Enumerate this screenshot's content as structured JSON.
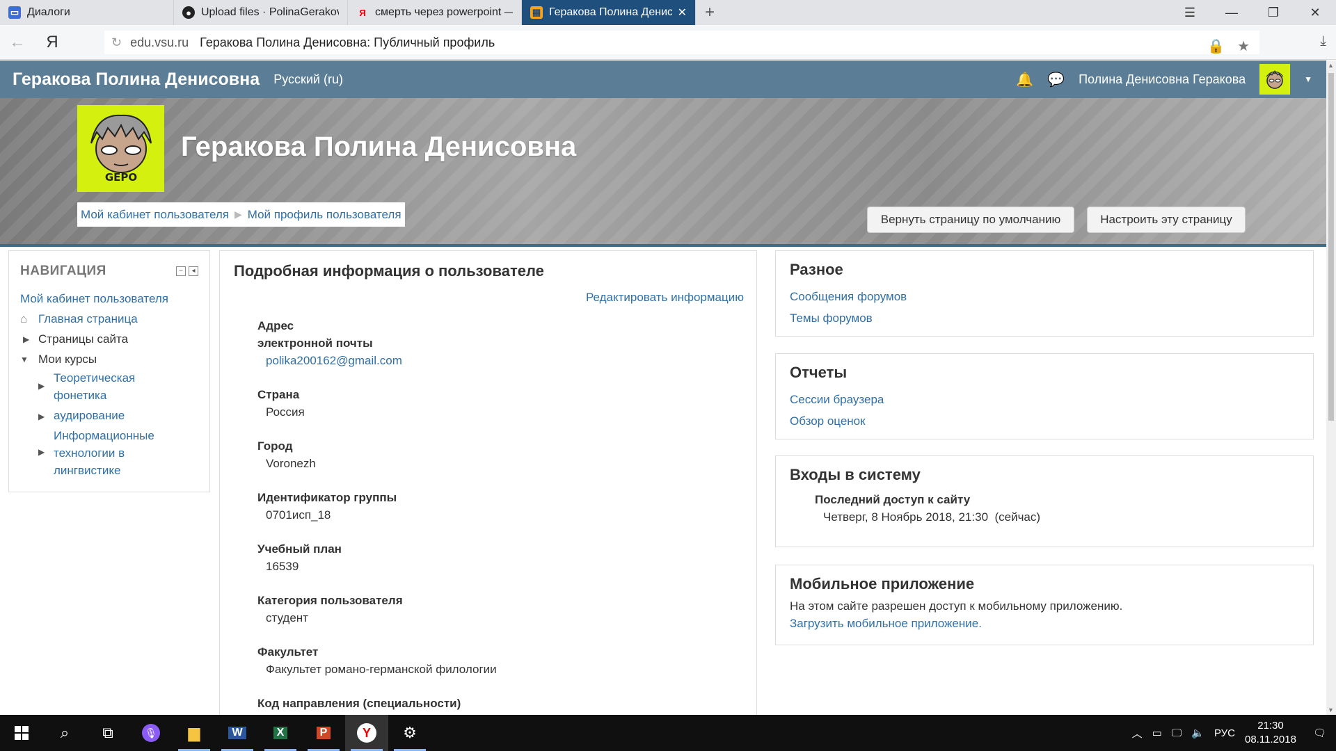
{
  "browser": {
    "tabs": [
      {
        "title": "Диалоги",
        "icon": "chat-icon",
        "active": false
      },
      {
        "title": "Upload files · PolinaGerakova",
        "icon": "github-icon",
        "active": false
      },
      {
        "title": "смерть через powerpoint —",
        "icon": "yandex-icon",
        "active": false
      },
      {
        "title": "Геракова Полина Денисовна",
        "icon": "moodle-icon",
        "active": true
      }
    ],
    "url_domain": "edu.vsu.ru",
    "url_title": "Геракова Полина Денисовна: Публичный профиль"
  },
  "navbar": {
    "brand": "Геракова Полина Денисовна",
    "lang": "Русский (ru)",
    "username": "Полина Денисовна Геракова"
  },
  "header": {
    "title": "Геракова Полина Денисовна",
    "avatar_text": "GEPO",
    "breadcrumb": [
      "Мой кабинет пользователя",
      "Мой профиль пользователя"
    ],
    "reset_button": "Вернуть страницу по умолчанию",
    "customize_button": "Настроить эту страницу"
  },
  "navigation": {
    "title": "НАВИГАЦИЯ",
    "dashboard": "Мой кабинет пользователя",
    "home": "Главная страница",
    "site_pages": "Страницы сайта",
    "my_courses": "Мои курсы",
    "courses": [
      {
        "line1": "Теоретическая",
        "line2": "фонетика",
        "line3": ""
      },
      {
        "line1": "аудирование",
        "line2": "",
        "line3": ""
      },
      {
        "line1": "Информационные",
        "line2": "технологии в",
        "line3": "лингвистике"
      }
    ]
  },
  "details": {
    "title": "Подробная информация о пользователе",
    "edit_link": "Редактировать информацию",
    "fields": [
      {
        "label1": "Адрес",
        "label2": "электронной почты",
        "value": "polika200162@gmail.com",
        "is_link": true
      },
      {
        "label1": "Страна",
        "label2": "",
        "value": "Россия",
        "is_link": false
      },
      {
        "label1": "Город",
        "label2": "",
        "value": "Voronezh",
        "is_link": false
      },
      {
        "label1": "Идентификатор группы",
        "label2": "",
        "value": "0701исп_18",
        "is_link": false
      },
      {
        "label1": "Учебный план",
        "label2": "",
        "value": "16539",
        "is_link": false
      },
      {
        "label1": "Категория пользователя",
        "label2": "",
        "value": "студент",
        "is_link": false
      },
      {
        "label1": "Факультет",
        "label2": "",
        "value": "Факультет романо-германской филологии",
        "is_link": false
      },
      {
        "label1": "Код направления (специальности)",
        "label2": "",
        "value": "",
        "is_link": false
      }
    ]
  },
  "misc": {
    "title": "Разное",
    "forum_posts": "Сообщения форумов",
    "forum_topics": "Темы форумов"
  },
  "reports": {
    "title": "Отчеты",
    "sessions": "Сессии браузера",
    "grades": "Обзор оценок"
  },
  "logins": {
    "title": "Входы в систему",
    "last_access_label": "Последний доступ к сайту",
    "last_access_value": "Четверг, 8 Ноябрь 2018, 21:30  (сейчас)"
  },
  "mobile": {
    "title": "Мобильное приложение",
    "text": "На этом сайте разрешен доступ к мобильному приложению.",
    "link": "Загрузить мобильное приложение."
  },
  "taskbar": {
    "lang": "РУС",
    "time": "21:30",
    "date": "08.11.2018"
  }
}
